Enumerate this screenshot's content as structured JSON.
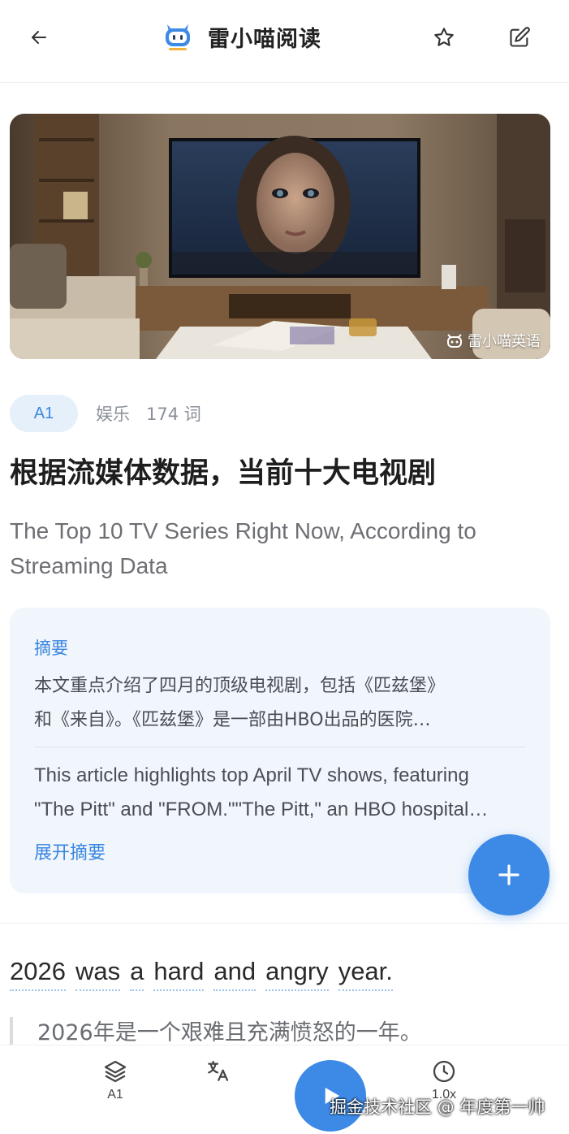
{
  "header": {
    "title": "雷小喵阅读",
    "back_icon": "back-arrow-icon",
    "logo_icon": "cat-robot-logo-icon",
    "favorite_icon": "star-icon",
    "edit_icon": "edit-icon"
  },
  "hero": {
    "watermark": "雷小喵英语"
  },
  "article": {
    "level": "A1",
    "category": "娱乐",
    "word_count": "174 词",
    "title_zh": "根据流媒体数据，当前十大电视剧",
    "title_en": "The Top 10 TV Series Right Now, According to Streaming Data"
  },
  "summary": {
    "label": "摘要",
    "zh_lines": [
      "本文重点介绍了四月的顶级电视剧，包括《匹兹堡》",
      "和《来自》。《匹兹堡》是一部由HBO出品的医院…"
    ],
    "en_lines": [
      "This article highlights top April TV shows, featuring",
      "\"The Pitt\" and \"FROM.\"\"The Pitt,\" an HBO hospital…"
    ],
    "expand": "展开摘要"
  },
  "sentence": {
    "words": [
      "2026",
      "was",
      "a",
      "hard",
      "and",
      "angry",
      "year."
    ],
    "translation": "2026年是一个艰难且充满愤怒的一年。"
  },
  "bottom_nav": {
    "level_label": "A1",
    "speed_label": "1.0x",
    "watermark": "掘金技术社区 @ 年度第一帅"
  },
  "colors": {
    "accent": "#3d8ae6",
    "badge_bg": "#e6f0fb",
    "summary_bg": "#f1f6fd"
  }
}
